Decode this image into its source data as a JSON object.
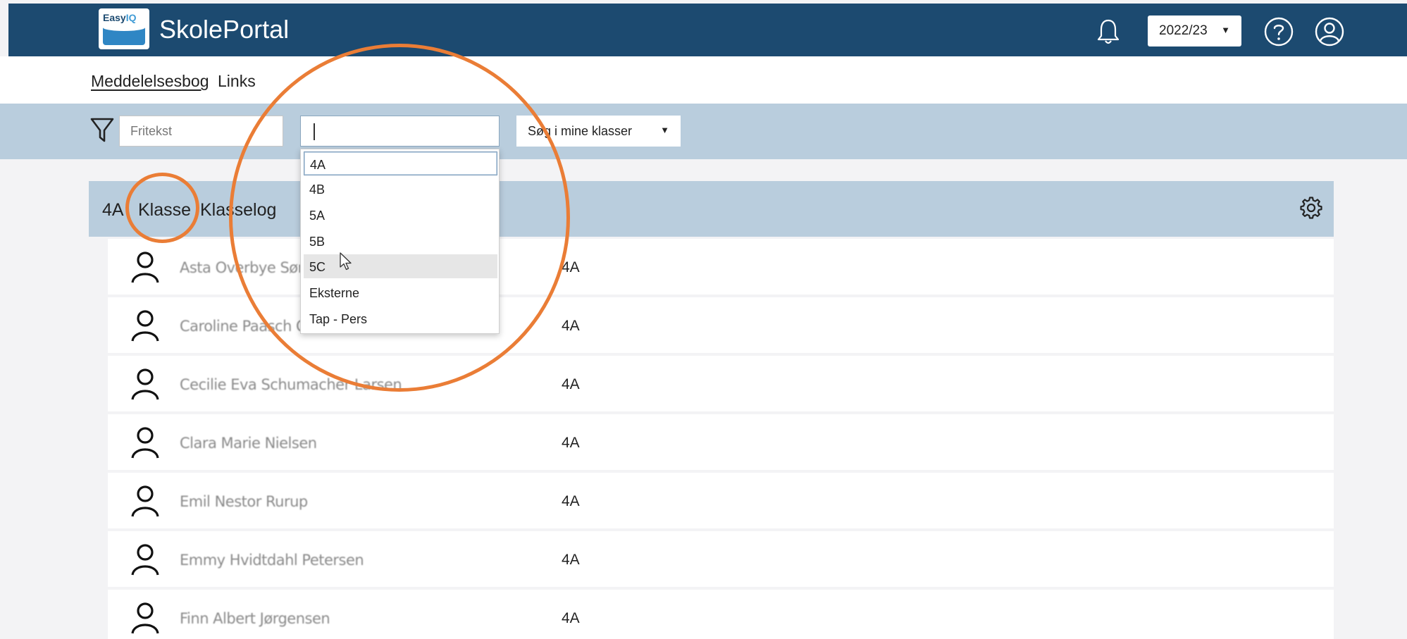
{
  "header": {
    "logo_text_a": "Easy",
    "logo_text_b": "IQ",
    "app_title": "SkolePortal",
    "school_year": "2022/23",
    "icons": [
      "bell-icon",
      "help-icon",
      "account-icon"
    ]
  },
  "subnav": {
    "items": [
      "Meddelelsesbog",
      "Links"
    ],
    "active": "Meddelelsesbog"
  },
  "filters": {
    "freetext_placeholder": "Fritekst",
    "class_value": "",
    "scope_label": "Søg i mine klasser"
  },
  "dropdown": {
    "options": [
      "4A",
      "4B",
      "5A",
      "5B",
      "5C",
      "Eksterne",
      "Tap - Pers"
    ],
    "selected": "4A",
    "hovered": "5C"
  },
  "class_header": {
    "code": "4A",
    "tab_class": "Klasse",
    "tab_log": "Klasselog"
  },
  "students": [
    {
      "name": "Asta Overbye Sørensen",
      "class": "4A"
    },
    {
      "name": "Caroline Paasch Olsen",
      "class": "4A"
    },
    {
      "name": "Cecilie Eva Schumacher Larsen",
      "class": "4A"
    },
    {
      "name": "Clara Marie Nielsen",
      "class": "4A"
    },
    {
      "name": "Emil Nestor Rurup",
      "class": "4A"
    },
    {
      "name": "Emmy Hvidtdahl Petersen",
      "class": "4A"
    },
    {
      "name": "Finn Albert Jørgensen",
      "class": "4A"
    }
  ],
  "colors": {
    "header_bg": "#1c4a70",
    "filter_bg": "#b9cddd",
    "annotation": "#ea7d36"
  }
}
